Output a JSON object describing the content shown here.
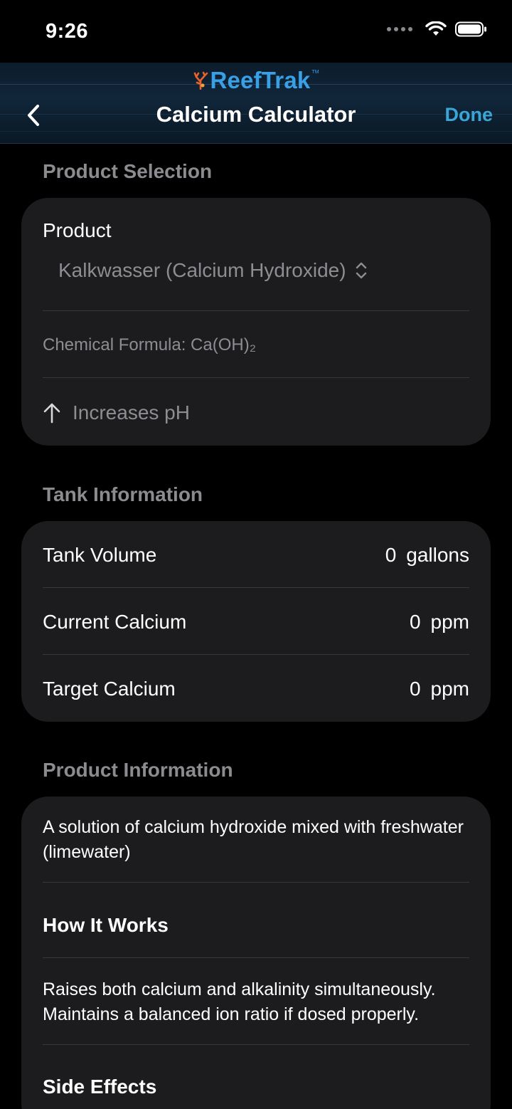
{
  "status": {
    "time": "9:26"
  },
  "nav": {
    "logo": "ReefTrak",
    "logo_tm": "TM",
    "title": "Calcium Calculator",
    "done": "Done"
  },
  "product_selection": {
    "header": "Product Selection",
    "product_label": "Product",
    "product_value": "Kalkwasser (Calcium Hydroxide)",
    "formula": "Chemical Formula: Ca(OH)₂",
    "effect": "Increases pH"
  },
  "tank_information": {
    "header": "Tank Information",
    "rows": [
      {
        "label": "Tank Volume",
        "value": "0",
        "unit": "gallons"
      },
      {
        "label": "Current Calcium",
        "value": "0",
        "unit": "ppm"
      },
      {
        "label": "Target Calcium",
        "value": "0",
        "unit": "ppm"
      }
    ]
  },
  "product_information": {
    "header": "Product Information",
    "description": "A solution of calcium hydroxide mixed with freshwater (limewater)",
    "how_title": "How It Works",
    "how_text": "Raises both calcium and alkalinity simultaneously. Maintains a balanced ion ratio if dosed properly.",
    "side_title": "Side Effects"
  },
  "colors": {
    "accent": "#3aa6d8",
    "card": "#1c1c1e",
    "muted": "#8d8d92",
    "logo": "#3aa0e6"
  }
}
